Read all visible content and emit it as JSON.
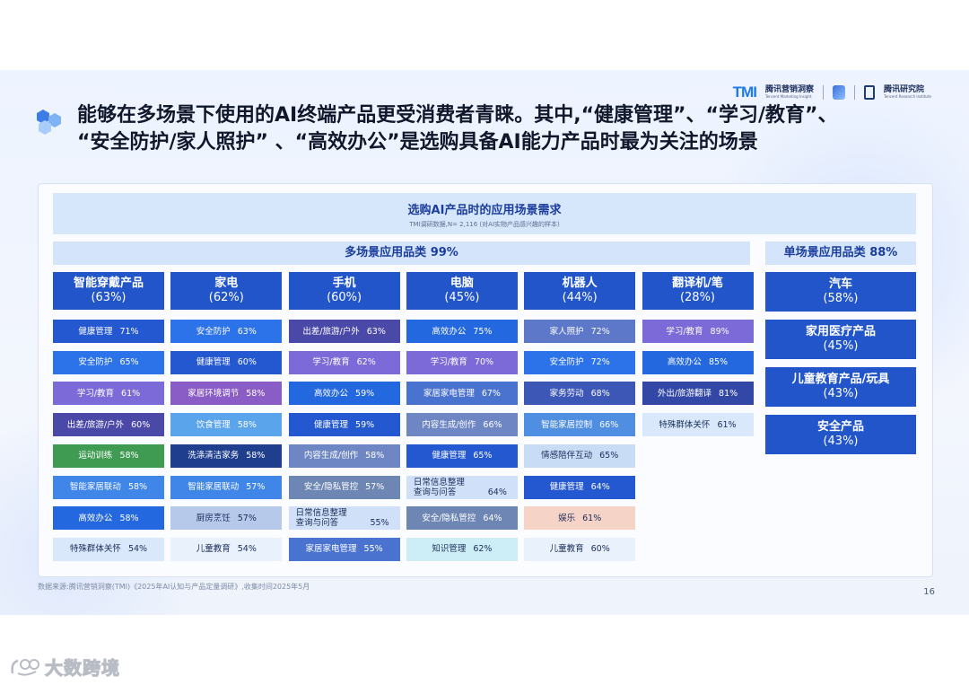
{
  "headline": "能够在多场景下使用的AI终端产品更受消费者青睐。其中,“健康管理”、“学习/教育”、\n“安全防护/家人照护” 、“高效办公”是选购具备AI能力产品时最为关注的场景",
  "logos": {
    "tmi_mark": "TMI",
    "tmi_name": "腾讯营销洞察",
    "tmi_sub": "Tencent Marketing Insight",
    "center_name": "腾讯研究院",
    "center_sub": "Tencent Research Institute"
  },
  "page_number": "16",
  "source": "数据来源:腾讯营销洞察(TMI)《2025年AI认知与产品定量调研》,收集时间2025年5月",
  "watermark": "大数跨境",
  "colors": {
    "category_header": "#2155c9",
    "banner": "#d6e6fb",
    "group_header": "#d3e4fb",
    "accent_title": "#1c3e9c"
  },
  "chart_data": {
    "type": "table",
    "title": "选购AI产品时的应用场景需求",
    "subtitle": "TMI调研数据,N= 2,116 (对AI实物产品感兴趣的样本)",
    "multi_group_label": "多场景应用品类 99%",
    "single_group_label": "单场景应用品类 88%",
    "multi_scene_categories": [
      {
        "name": "智能穿戴产品",
        "share": "(63%)",
        "scenes": [
          {
            "label": "健康管理",
            "value": "71%",
            "bg": "#2458d0",
            "fg": "#ffffff"
          },
          {
            "label": "安全防护",
            "value": "65%",
            "bg": "#2c72e8",
            "fg": "#ffffff"
          },
          {
            "label": "学习/教育",
            "value": "61%",
            "bg": "#7c6ad8",
            "fg": "#ffffff"
          },
          {
            "label": "出差/旅游/户外",
            "value": "60%",
            "bg": "#4b49a8",
            "fg": "#ffffff"
          },
          {
            "label": "运动训练",
            "value": "58%",
            "bg": "#3f9a52",
            "fg": "#ffffff"
          },
          {
            "label": "智能家居联动",
            "value": "58%",
            "bg": "#3f86e8",
            "fg": "#ffffff"
          },
          {
            "label": "高效办公",
            "value": "58%",
            "bg": "#2468e0",
            "fg": "#ffffff"
          },
          {
            "label": "特殊群体关怀",
            "value": "54%",
            "bg": "#d9e9fb",
            "fg": "#1c2d5a"
          }
        ]
      },
      {
        "name": "家电",
        "share": "(62%)",
        "scenes": [
          {
            "label": "安全防护",
            "value": "63%",
            "bg": "#2c72e8",
            "fg": "#ffffff"
          },
          {
            "label": "健康管理",
            "value": "60%",
            "bg": "#2458d0",
            "fg": "#ffffff"
          },
          {
            "label": "家居环境调节",
            "value": "58%",
            "bg": "#8a5cc6",
            "fg": "#ffffff"
          },
          {
            "label": "饮食管理",
            "value": "58%",
            "bg": "#5aa4ec",
            "fg": "#ffffff"
          },
          {
            "label": "洗涤清洁家务",
            "value": "58%",
            "bg": "#1f3f8e",
            "fg": "#ffffff"
          },
          {
            "label": "智能家居联动",
            "value": "57%",
            "bg": "#3f86e8",
            "fg": "#ffffff"
          },
          {
            "label": "厨房烹饪",
            "value": "57%",
            "bg": "#b7c9ea",
            "fg": "#1c2d5a"
          },
          {
            "label": "儿童教育",
            "value": "54%",
            "bg": "#e8f1fc",
            "fg": "#1c2d5a"
          }
        ]
      },
      {
        "name": "手机",
        "share": "(60%)",
        "scenes": [
          {
            "label": "出差/旅游/户外",
            "value": "63%",
            "bg": "#4b49a8",
            "fg": "#ffffff"
          },
          {
            "label": "学习/教育",
            "value": "62%",
            "bg": "#7c6ad8",
            "fg": "#ffffff"
          },
          {
            "label": "高效办公",
            "value": "59%",
            "bg": "#2468e0",
            "fg": "#ffffff"
          },
          {
            "label": "健康管理",
            "value": "59%",
            "bg": "#2458d0",
            "fg": "#ffffff"
          },
          {
            "label": "内容生成/创作",
            "value": "58%",
            "bg": "#6e87c4",
            "fg": "#ffffff"
          },
          {
            "label": "安全/隐私管控",
            "value": "57%",
            "bg": "#6e86b4",
            "fg": "#ffffff"
          },
          {
            "label": "日常信息整理\n查询与问答",
            "value": "55%",
            "bg": "#cfe0f8",
            "fg": "#1c2d5a",
            "multiline": true
          },
          {
            "label": "家居家电管理",
            "value": "55%",
            "bg": "#4a73cf",
            "fg": "#ffffff"
          }
        ]
      },
      {
        "name": "电脑",
        "share": "(45%)",
        "scenes": [
          {
            "label": "高效办公",
            "value": "75%",
            "bg": "#2468e0",
            "fg": "#ffffff"
          },
          {
            "label": "学习/教育",
            "value": "70%",
            "bg": "#7c6ad8",
            "fg": "#ffffff"
          },
          {
            "label": "家居家电管理",
            "value": "67%",
            "bg": "#4a73cf",
            "fg": "#ffffff"
          },
          {
            "label": "内容生成/创作",
            "value": "66%",
            "bg": "#6e87c4",
            "fg": "#ffffff"
          },
          {
            "label": "健康管理",
            "value": "65%",
            "bg": "#2458d0",
            "fg": "#ffffff"
          },
          {
            "label": "日常信息整理\n查询与问答",
            "value": "64%",
            "bg": "#cfe0f8",
            "fg": "#1c2d5a",
            "multiline": true
          },
          {
            "label": "安全/隐私管控",
            "value": "64%",
            "bg": "#6e86b4",
            "fg": "#ffffff"
          },
          {
            "label": "知识管理",
            "value": "62%",
            "bg": "#cdeef6",
            "fg": "#1c2d5a"
          }
        ]
      },
      {
        "name": "机器人",
        "share": "(44%)",
        "scenes": [
          {
            "label": "家人照护",
            "value": "72%",
            "bg": "#5d78c8",
            "fg": "#ffffff"
          },
          {
            "label": "安全防护",
            "value": "72%",
            "bg": "#2c72e8",
            "fg": "#ffffff"
          },
          {
            "label": "家务劳动",
            "value": "68%",
            "bg": "#3c57b6",
            "fg": "#ffffff"
          },
          {
            "label": "智能家居控制",
            "value": "66%",
            "bg": "#4f8ee0",
            "fg": "#ffffff"
          },
          {
            "label": "情感陪伴互动",
            "value": "65%",
            "bg": "#c8dcf6",
            "fg": "#1c2d5a"
          },
          {
            "label": "健康管理",
            "value": "64%",
            "bg": "#2458d0",
            "fg": "#ffffff"
          },
          {
            "label": "娱乐",
            "value": "61%",
            "bg": "#f5d3c6",
            "fg": "#1c2d5a"
          },
          {
            "label": "儿童教育",
            "value": "60%",
            "bg": "#e8f1fc",
            "fg": "#1c2d5a"
          }
        ]
      },
      {
        "name": "翻译机/笔",
        "share": "(28%)",
        "scenes": [
          {
            "label": "学习/教育",
            "value": "89%",
            "bg": "#7c6ad8",
            "fg": "#ffffff"
          },
          {
            "label": "高效办公",
            "value": "85%",
            "bg": "#2468e0",
            "fg": "#ffffff"
          },
          {
            "label": "外出/旅游翻译",
            "value": "81%",
            "bg": "#3348a6",
            "fg": "#ffffff"
          },
          {
            "label": "特殊群体关怀",
            "value": "61%",
            "bg": "#d9e9fb",
            "fg": "#1c2d5a"
          }
        ]
      }
    ],
    "single_scene_categories": [
      {
        "name": "汽车",
        "share": "(58%)"
      },
      {
        "name": "家用医疗产品",
        "share": "(45%)"
      },
      {
        "name": "儿童教育产品/玩具",
        "share": "(43%)"
      },
      {
        "name": "安全产品",
        "share": "(43%)"
      }
    ]
  }
}
